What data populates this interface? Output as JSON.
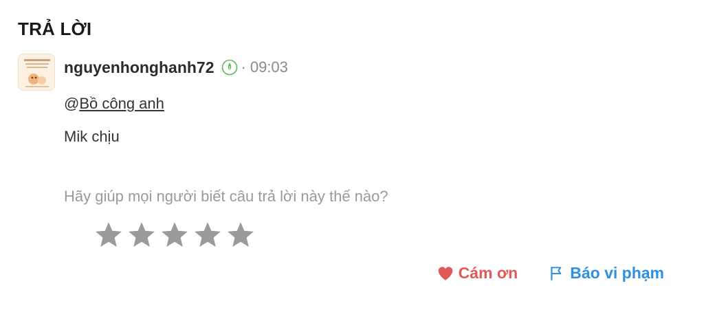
{
  "section": {
    "title": "TRẢ LỜI"
  },
  "answer": {
    "username": "nguyenhonghanh72",
    "separator": "·",
    "time": "09:03",
    "mention_prefix": "@",
    "mention_name": "Bồ công anh",
    "text": "Mik chịu",
    "rank_icon": "leaf-badge-icon",
    "avatar_icon": "user-avatar"
  },
  "rating": {
    "prompt": "Hãy giúp mọi người biết câu trả lời này thế nào?",
    "max_stars": 5,
    "current_rating": 0,
    "star_color": "#9a9a9a"
  },
  "actions": {
    "thanks_label": "Cám ơn",
    "thanks_icon": "heart-icon",
    "thanks_color": "#e05a5a",
    "report_label": "Báo vi phạm",
    "report_icon": "flag-icon",
    "report_color": "#2f8fe0"
  }
}
